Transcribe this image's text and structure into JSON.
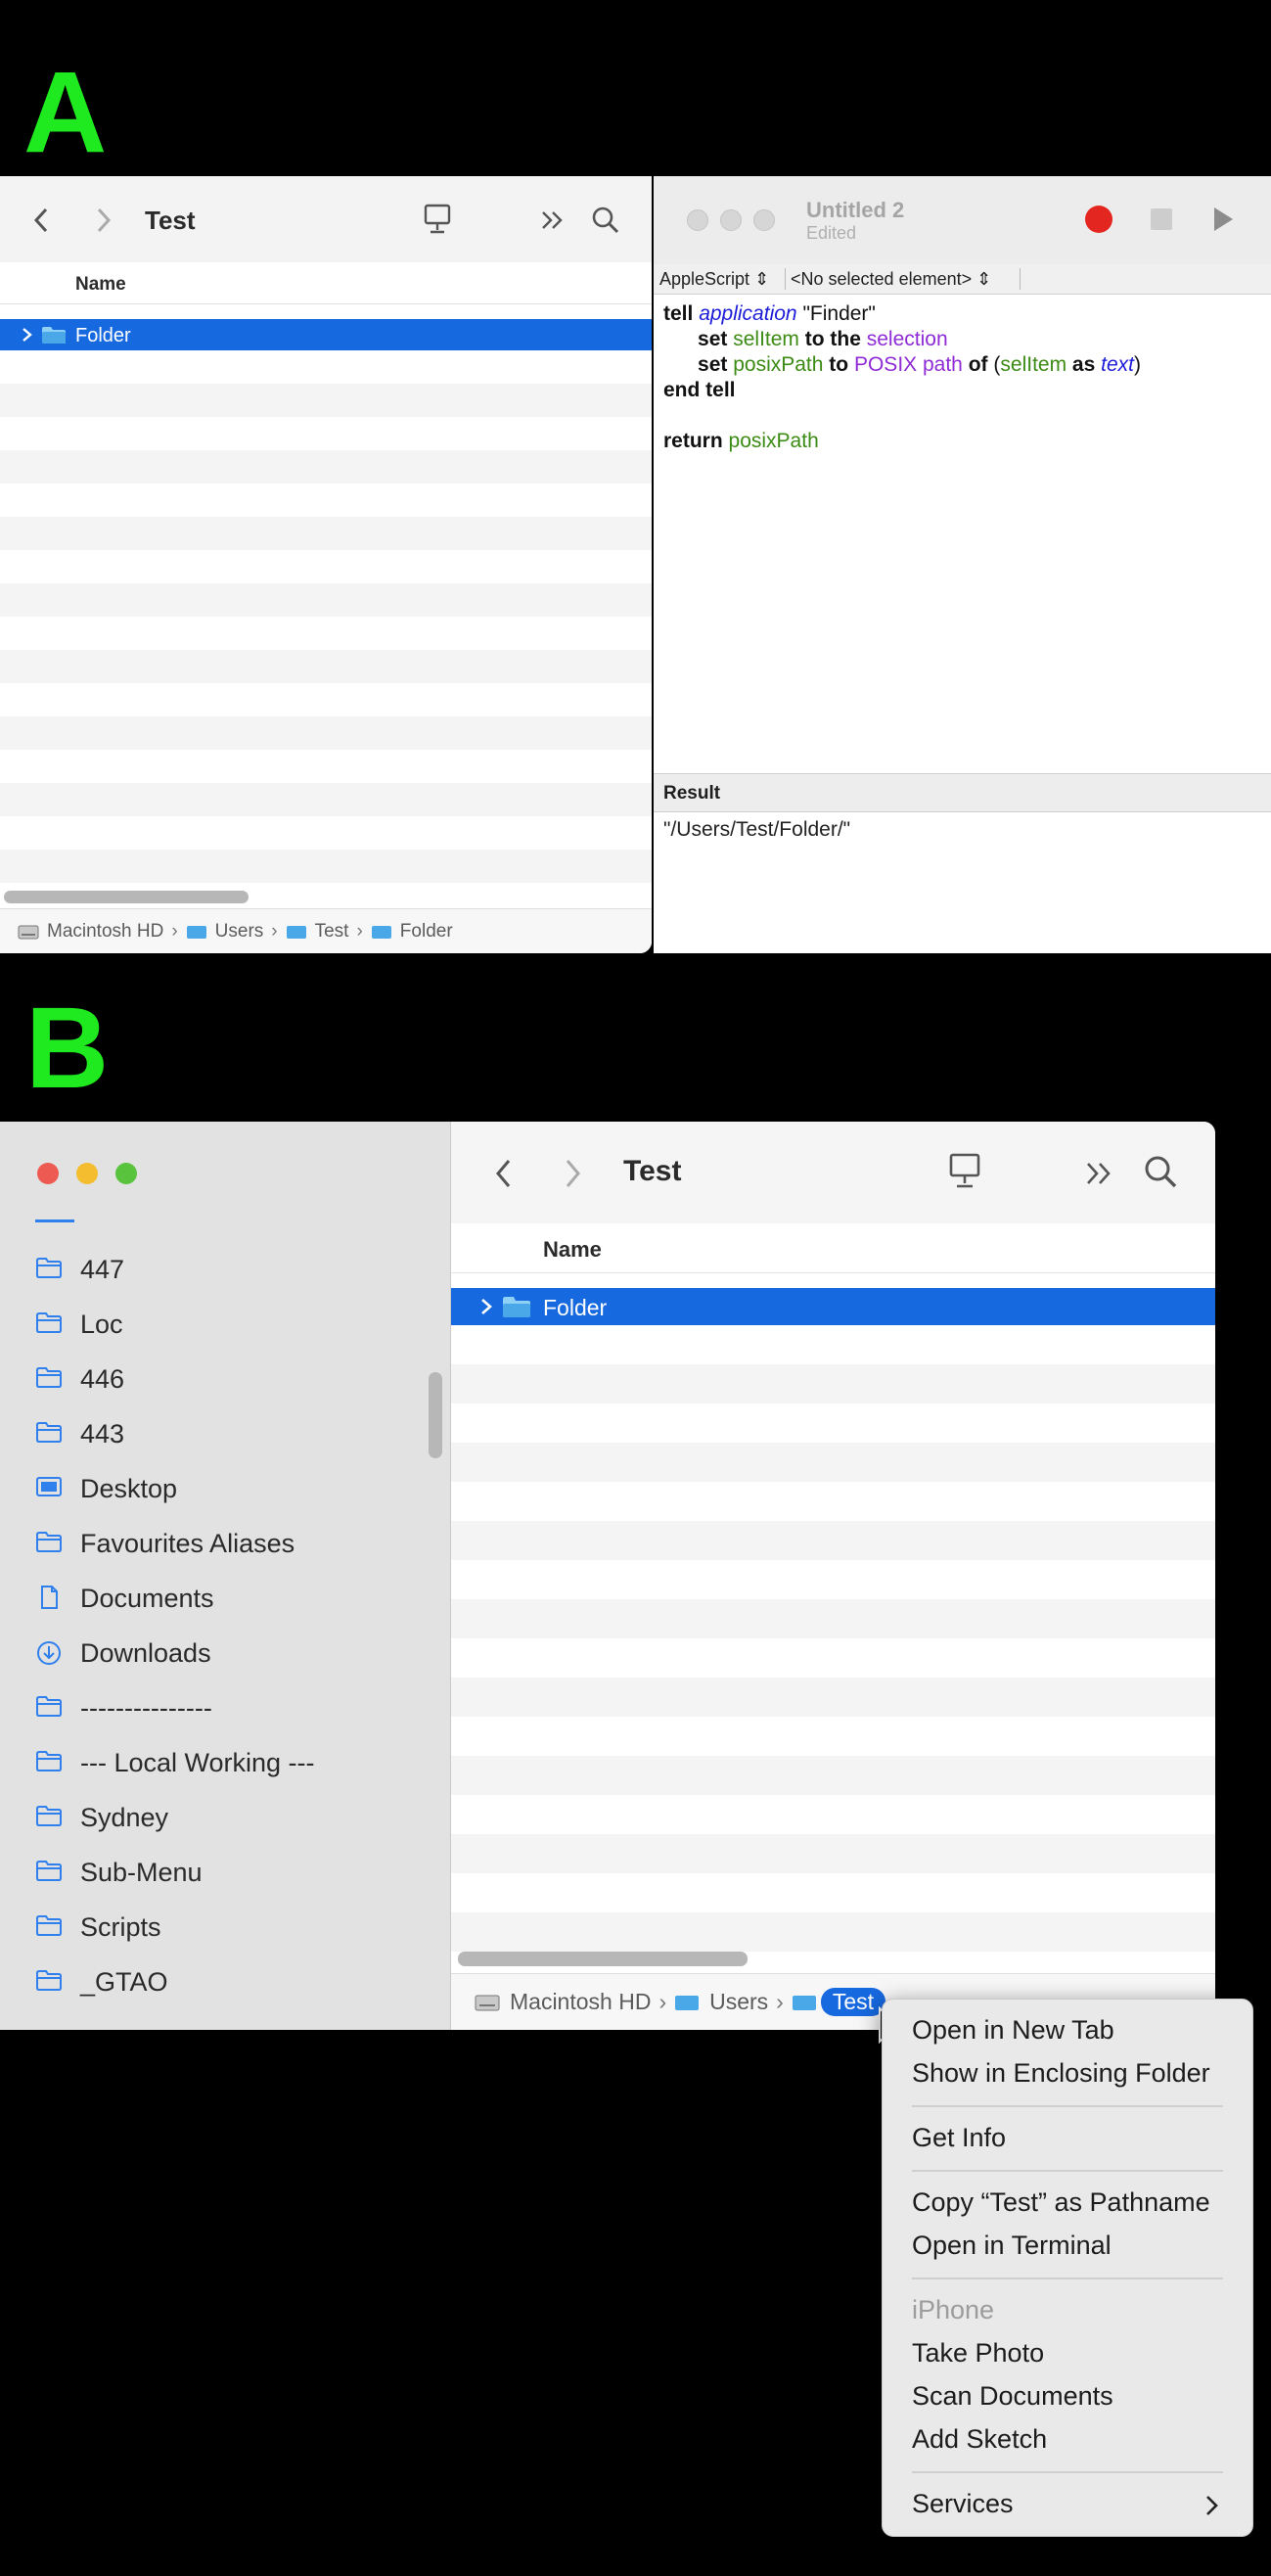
{
  "panel_a_label": "A",
  "panel_b_label": "B",
  "finder_a": {
    "title": "Test",
    "column_name": "Name",
    "selected_row": "Folder",
    "path": [
      "Macintosh HD",
      "Users",
      "Test",
      "Folder"
    ]
  },
  "script_editor": {
    "window_title": "Untitled 2",
    "subtitle": "Edited",
    "language_popup": "AppleScript",
    "element_popup": "<No selected element>",
    "code": {
      "l1_tell": "tell",
      "l1_application": "application",
      "l1_finder": "\"Finder\"",
      "l2_set": "set",
      "l2_selitem": "selItem",
      "l2_to_the": "to the",
      "l2_selection": "selection",
      "l3_set": "set",
      "l3_posixpath": "posixPath",
      "l3_to": "to",
      "l3_posix_path": "POSIX path",
      "l3_of": "of",
      "l3_paren_open": "(",
      "l3_selitem": "selItem",
      "l3_as": "as",
      "l3_text": "text",
      "l3_paren_close": ")",
      "l4_end_tell": "end tell",
      "l6_return": "return",
      "l6_posixpath": "posixPath"
    },
    "result_header": "Result",
    "result_value": "\"/Users/Test/Folder/\""
  },
  "finder_b": {
    "title": "Test",
    "column_name": "Name",
    "selected_row": "Folder",
    "sidebar_items": [
      {
        "label": "447",
        "icon": "folder-icon"
      },
      {
        "label": "Loc",
        "icon": "folder-icon"
      },
      {
        "label": "446",
        "icon": "folder-icon"
      },
      {
        "label": "443",
        "icon": "folder-icon"
      },
      {
        "label": "Desktop",
        "icon": "desktop-icon"
      },
      {
        "label": "Favourites Aliases",
        "icon": "folder-icon"
      },
      {
        "label": "Documents",
        "icon": "document-icon"
      },
      {
        "label": "Downloads",
        "icon": "download-icon"
      },
      {
        "label": "---------------",
        "icon": "folder-icon"
      },
      {
        "label": "--- Local Working ---",
        "icon": "folder-icon"
      },
      {
        "label": "Sydney",
        "icon": "folder-icon"
      },
      {
        "label": "Sub-Menu",
        "icon": "folder-icon"
      },
      {
        "label": "Scripts",
        "icon": "folder-icon"
      },
      {
        "label": "_GTAO",
        "icon": "folder-icon"
      }
    ],
    "path": [
      "Macintosh HD",
      "Users",
      "Test"
    ]
  },
  "context_menu": {
    "items": [
      {
        "label": "Open in New Tab",
        "enabled": true
      },
      {
        "label": "Show in Enclosing Folder",
        "enabled": true
      },
      {
        "label": "Get Info",
        "enabled": true
      },
      {
        "label": "Copy “Test” as Pathname",
        "enabled": true
      },
      {
        "label": "Open in Terminal",
        "enabled": true
      },
      {
        "label": "iPhone",
        "enabled": false
      },
      {
        "label": "Take Photo",
        "enabled": true
      },
      {
        "label": "Scan Documents",
        "enabled": true
      },
      {
        "label": "Add Sketch",
        "enabled": true
      },
      {
        "label": "Services",
        "enabled": true
      }
    ]
  },
  "colors": {
    "label_green": "#1fea1f",
    "selection_blue": "#1769e0",
    "record_red": "#e3261f",
    "folder_blue": "#4aa8e8"
  }
}
